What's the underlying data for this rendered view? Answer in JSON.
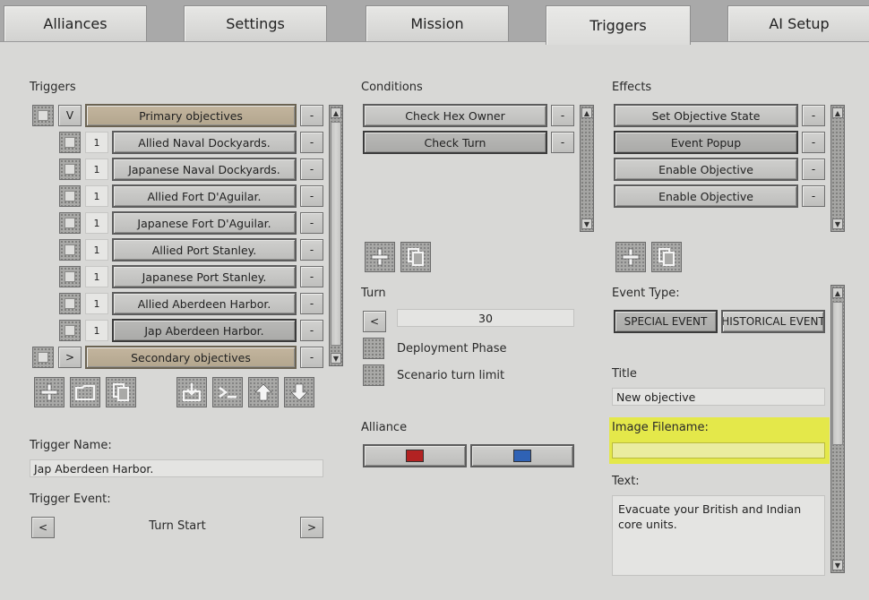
{
  "tabs": [
    {
      "label": "Alliances",
      "active": false
    },
    {
      "label": "Settings",
      "active": false
    },
    {
      "label": "Mission",
      "active": false
    },
    {
      "label": "Triggers",
      "active": true
    },
    {
      "label": "AI Setup",
      "active": false
    }
  ],
  "triggers": {
    "section_label": "Triggers",
    "groups": [
      {
        "toggle": "V",
        "label": "Primary objectives"
      },
      {
        "toggle": ">",
        "label": "Secondary objectives"
      }
    ],
    "items": [
      {
        "count": "1",
        "label": "Allied Naval Dockyards."
      },
      {
        "count": "1",
        "label": "Japanese Naval Dockyards."
      },
      {
        "count": "1",
        "label": "Allied Fort D'Aguilar."
      },
      {
        "count": "1",
        "label": "Japanese Fort D'Aguilar."
      },
      {
        "count": "1",
        "label": "Allied Port Stanley."
      },
      {
        "count": "1",
        "label": "Japanese Port Stanley."
      },
      {
        "count": "1",
        "label": "Allied Aberdeen Harbor."
      },
      {
        "count": "1",
        "label": "Jap Aberdeen Harbor."
      }
    ],
    "remove_symbol": "-",
    "name_label": "Trigger Name:",
    "name_value": "Jap Aberdeen Harbor.",
    "event_label": "Trigger Event:",
    "event_value": "Turn Start",
    "prev_symbol": "<",
    "next_symbol": ">"
  },
  "conditions": {
    "section_label": "Conditions",
    "items": [
      {
        "label": "Check Hex Owner"
      },
      {
        "label": "Check Turn"
      }
    ],
    "turn_label": "Turn",
    "turn_value": "30",
    "deployment_label": "Deployment Phase",
    "turn_limit_label": "Scenario turn limit",
    "alliance_label": "Alliance",
    "alliance_colors": [
      "#b22222",
      "#2f62b5"
    ]
  },
  "effects": {
    "section_label": "Effects",
    "items": [
      {
        "label": "Set Objective State"
      },
      {
        "label": "Event Popup"
      },
      {
        "label": "Enable Objective"
      },
      {
        "label": "Enable Objective"
      }
    ],
    "event_type_label": "Event Type:",
    "event_types": [
      "SPECIAL EVENT",
      "HISTORICAL EVENT"
    ],
    "title_label": "Title",
    "title_value": "New objective",
    "image_label": "Image Filename:",
    "image_value": "",
    "text_label": "Text:",
    "text_value": "Evacuate your British and Indian core units."
  },
  "colors": {
    "highlight": "#e4e84a",
    "gold_button": "#b9ab94",
    "panel": "#d8d8d6"
  }
}
